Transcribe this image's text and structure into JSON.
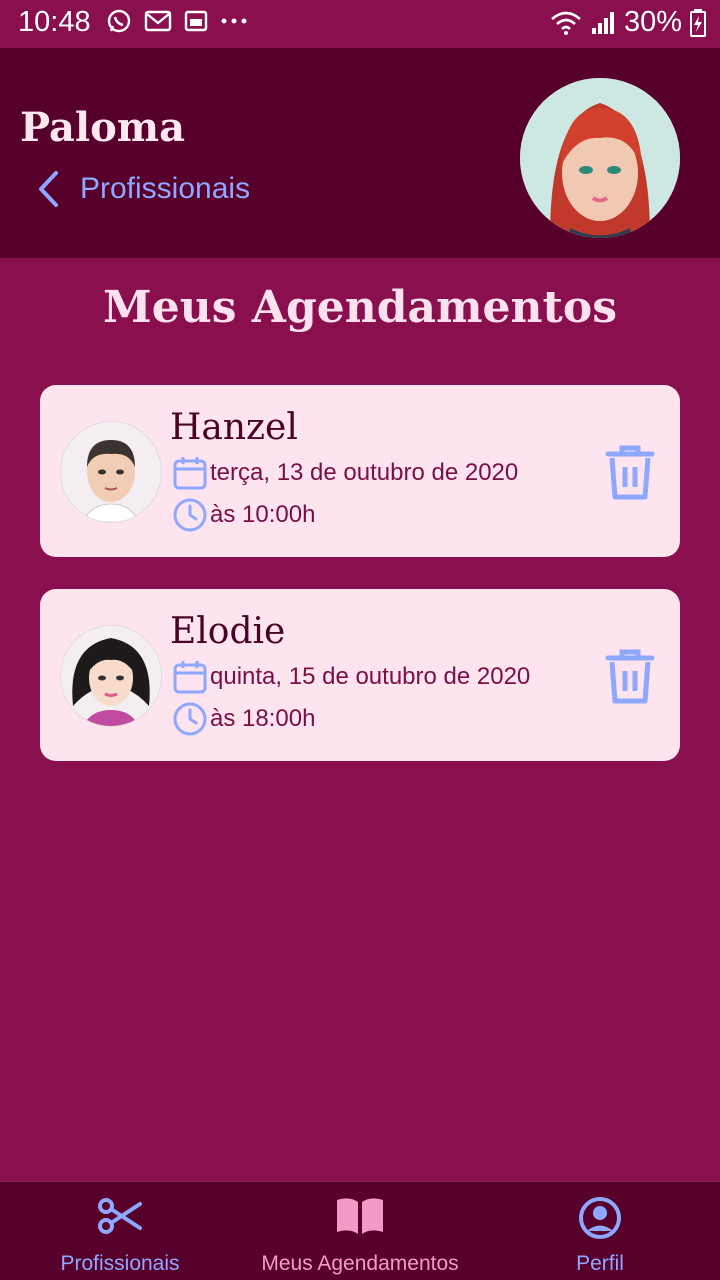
{
  "status_bar": {
    "time": "10:48",
    "battery": "30%"
  },
  "header": {
    "user_name": "Paloma",
    "back_label": "Profissionais"
  },
  "page_title": "Meus Agendamentos",
  "appointments": [
    {
      "professional": "Hanzel",
      "date": "terça, 13 de outubro de 2020",
      "time": "às 10:00h"
    },
    {
      "professional": "Elodie",
      "date": "quinta, 15 de outubro de 2020",
      "time": "às 18:00h"
    }
  ],
  "tabs": [
    {
      "label": "Profissionais",
      "icon": "scissors-icon",
      "color": "#8fa8ff"
    },
    {
      "label": "Meus Agendamentos",
      "icon": "book-icon",
      "color": "#f29bc5"
    },
    {
      "label": "Perfil",
      "icon": "user-circle-icon",
      "color": "#8fa8ff"
    }
  ],
  "colors": {
    "background": "#8a0f4f",
    "header": "#56002b",
    "card": "#fde4ee",
    "accent_blue": "#8fa8ff",
    "accent_pink": "#f29bc5"
  }
}
